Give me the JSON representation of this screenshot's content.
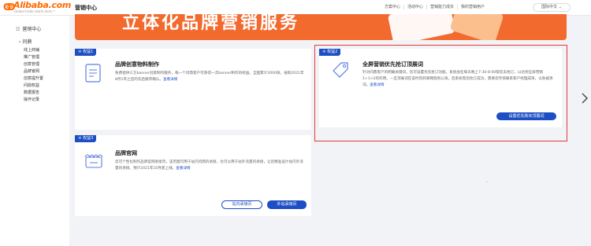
{
  "header": {
    "logo_text": "Alibaba.com",
    "logo_sub": "Global trade starts here.™",
    "app_title": "营销中心",
    "nav": [
      "方案中心",
      "活动中心",
      "营销能力成长",
      "我的营销用户"
    ],
    "language": "国际中文"
  },
  "sidebar": {
    "title": "营销中心",
    "section": "问鼎",
    "items": [
      "线上商铺",
      "推广管理",
      "创意管理",
      "品牌官网",
      "创意提升置",
      "问鼎权益",
      "数据报告",
      "操作记录"
    ]
  },
  "hero": {
    "text": "立体化品牌营销服务"
  },
  "cards": [
    {
      "tag": "权益1",
      "title": "品牌创意物料制作",
      "desc": "免费提供三方banner创意制作服务，每一个问鼎客户可获得一次banner制作的权益。全国累计2000张，按照2021年8月1年之后的先后顺序确认。",
      "more": "查看详情"
    },
    {
      "tag": "权益2",
      "title": "全屏营销优先抢订顶展词",
      "desc": "针对问鼎客户的明确关键词，您可设置优先抢订功能。系统会在每天晚上7:30-8:00帮您去抢订，以达到全屏营销1+1>2的作用。一旦顶展词在该时刻到来释放到公海，且系统帮您抢订成功，需要您尽快联系客户经理成单，以免被清词。",
      "more": "查看详情",
      "button": "设置优先购买顶展词"
    },
    {
      "tag": "权益3",
      "title": "品牌官网",
      "desc": "您可个性化制作品牌官网承接页，该页面可用于站内问鼎的承接，也可以用于站外流量的承接，让您精准设计站内外流量的承接。预计2021年10月底上线。",
      "more": "查看详情",
      "btn_outline": "站内承接页",
      "btn_fill": "外站承接页"
    }
  ]
}
